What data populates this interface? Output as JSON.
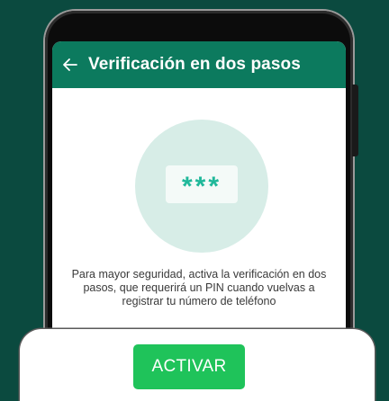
{
  "appbar": {
    "title": "Verificación en dos pasos",
    "back_icon": "arrow-left-icon"
  },
  "illustration": {
    "pin_mask": "***"
  },
  "description": "Para mayor seguridad, activa la verificación en dos pasos, que requerirá un PIN cuando vuelvas a registrar tu número de teléfono",
  "actions": {
    "activate_label": "ACTIVAR"
  },
  "colors": {
    "background": "#0b4a3f",
    "appbar": "#0c7a5e",
    "accent_button": "#1fc35a",
    "pin_text": "#1fb89a"
  }
}
